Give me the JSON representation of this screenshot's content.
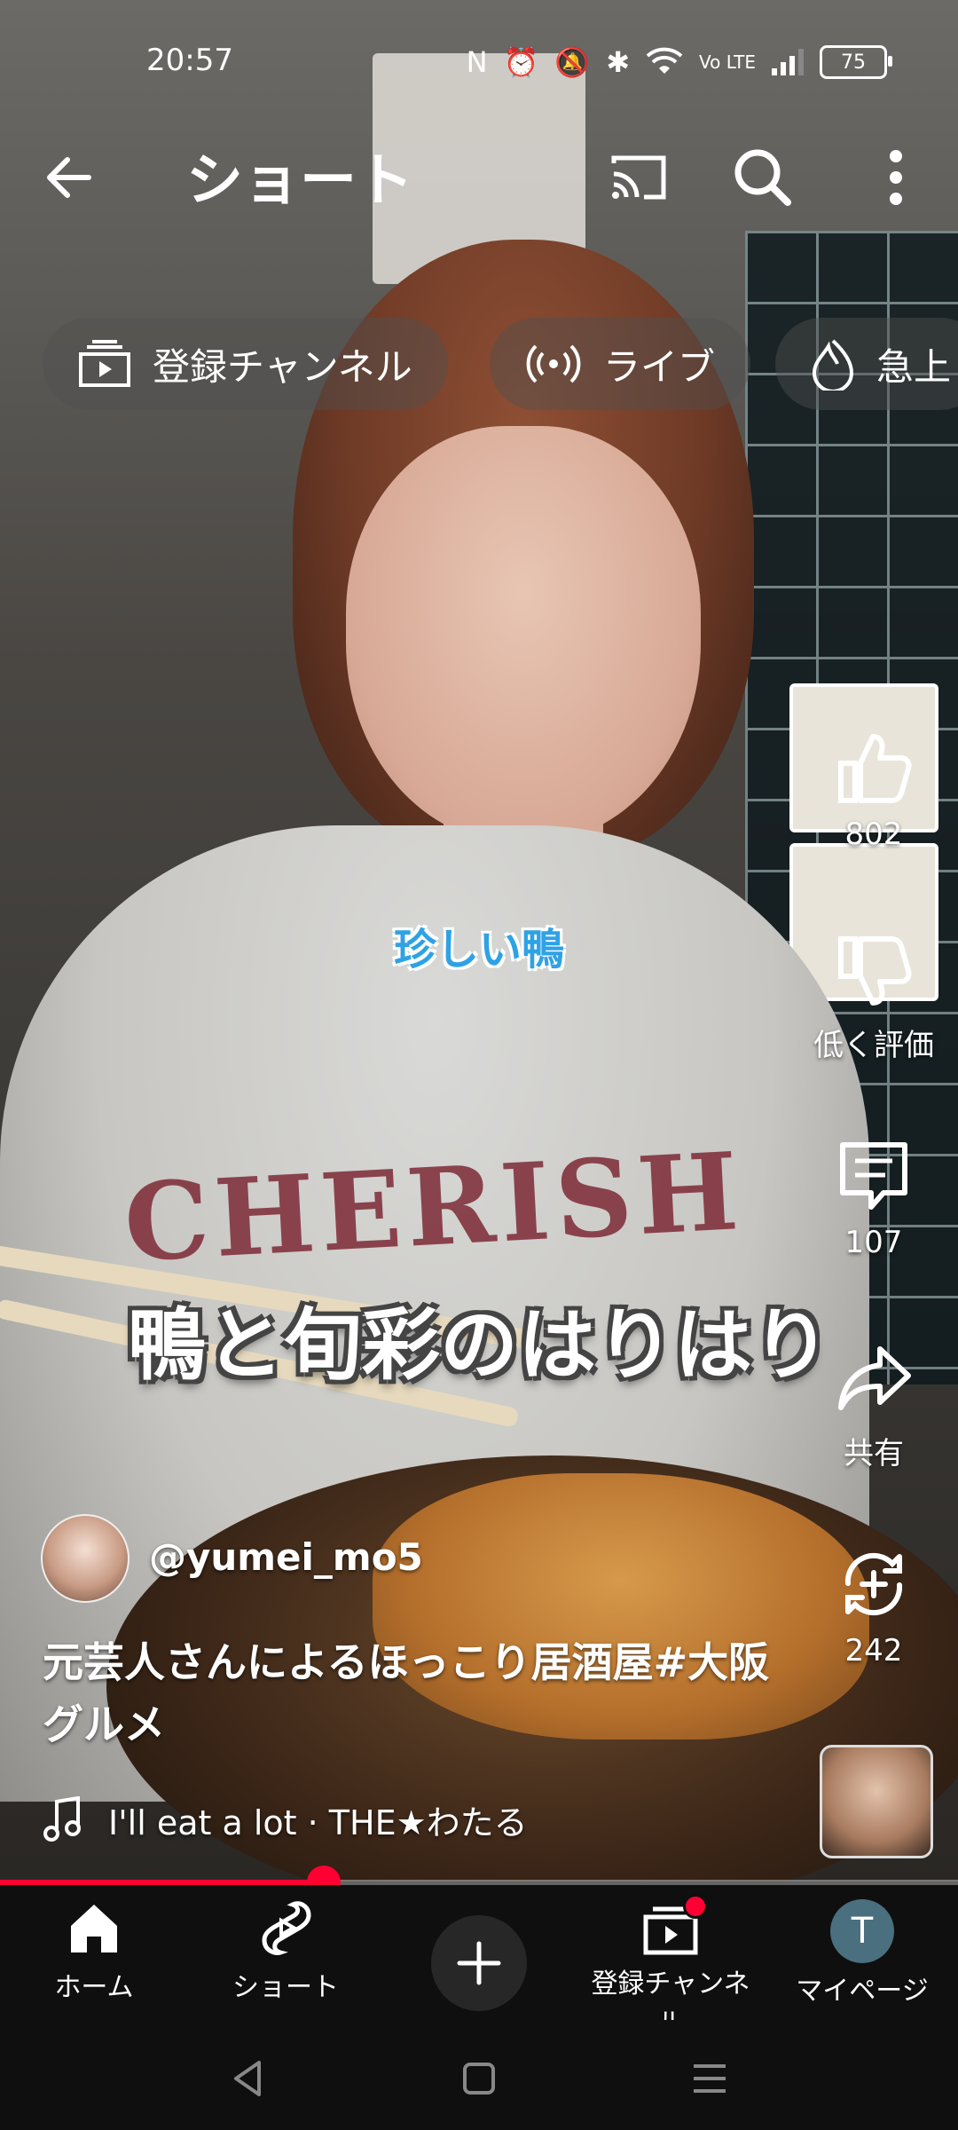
{
  "status_bar": {
    "time": "20:57",
    "battery": "75",
    "icons": [
      "nfc-icon",
      "alarm-icon",
      "mute-icon",
      "bluetooth-icon",
      "wifi-icon",
      "volte-icon",
      "signal-icon",
      "battery-icon"
    ]
  },
  "top_bar": {
    "title": "ショート",
    "icons": [
      "back-arrow-icon",
      "cast-icon",
      "search-icon",
      "more-vert-icon"
    ]
  },
  "chips": [
    {
      "label": "登録チャンネル",
      "icon": "subscriptions-icon"
    },
    {
      "label": "ライブ",
      "icon": "live-icon"
    },
    {
      "label": "急上",
      "icon": "trending-icon"
    }
  ],
  "video": {
    "caption_small": "珍しい鴨",
    "caption_big": "鴨と旬彩のはりはり",
    "shirt_text": "CHERISH"
  },
  "actions": {
    "like": {
      "count": "802",
      "icon": "thumb-up-icon"
    },
    "dislike": {
      "label": "低く評価",
      "icon": "thumb-down-icon"
    },
    "comments": {
      "count": "107",
      "icon": "comment-icon"
    },
    "share": {
      "label": "共有",
      "icon": "share-icon"
    },
    "remix": {
      "count": "242",
      "icon": "remix-icon"
    }
  },
  "channel": {
    "handle": "@yumei_mo5"
  },
  "title": "元芸人さんによるほっこり居酒屋#大阪グルメ",
  "music": {
    "text": "I'll eat a lot · THE★わたる",
    "icon": "music-note-icon"
  },
  "progress": {
    "fraction": 0.338
  },
  "bottom_nav": [
    {
      "label": "ホーム",
      "icon": "home-icon"
    },
    {
      "label": "ショート",
      "icon": "shorts-icon"
    },
    {
      "label": "",
      "icon": "add-icon"
    },
    {
      "label": "登録チャンネル",
      "icon": "subscriptions-icon"
    },
    {
      "label": "マイページ",
      "icon": "avatar-icon",
      "avatar_letter": "T"
    }
  ],
  "colors": {
    "accent": "#ff0033",
    "caption_blue": "#2fa2e6"
  }
}
